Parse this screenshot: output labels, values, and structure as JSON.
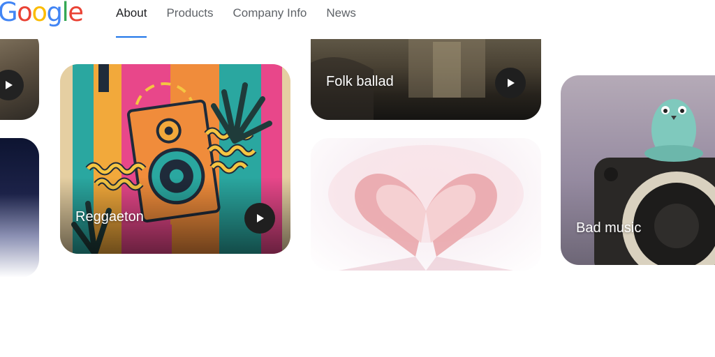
{
  "header": {
    "logo": [
      "G",
      "o",
      "o",
      "g",
      "l",
      "e"
    ],
    "nav": [
      {
        "label": "About",
        "active": true
      },
      {
        "label": "Products",
        "active": false
      },
      {
        "label": "Company Info",
        "active": false
      },
      {
        "label": "News",
        "active": false
      }
    ]
  },
  "colors": {
    "logo": [
      "#4285F4",
      "#EA4335",
      "#FBBC05",
      "#4285F4",
      "#34A853",
      "#EA4335"
    ],
    "nav_active_underline": "#1a73e8"
  },
  "cards": {
    "reggaeton": {
      "label": "Reggaeton"
    },
    "folk": {
      "label": "Folk ballad"
    },
    "bad_music": {
      "label": "Bad music"
    }
  }
}
